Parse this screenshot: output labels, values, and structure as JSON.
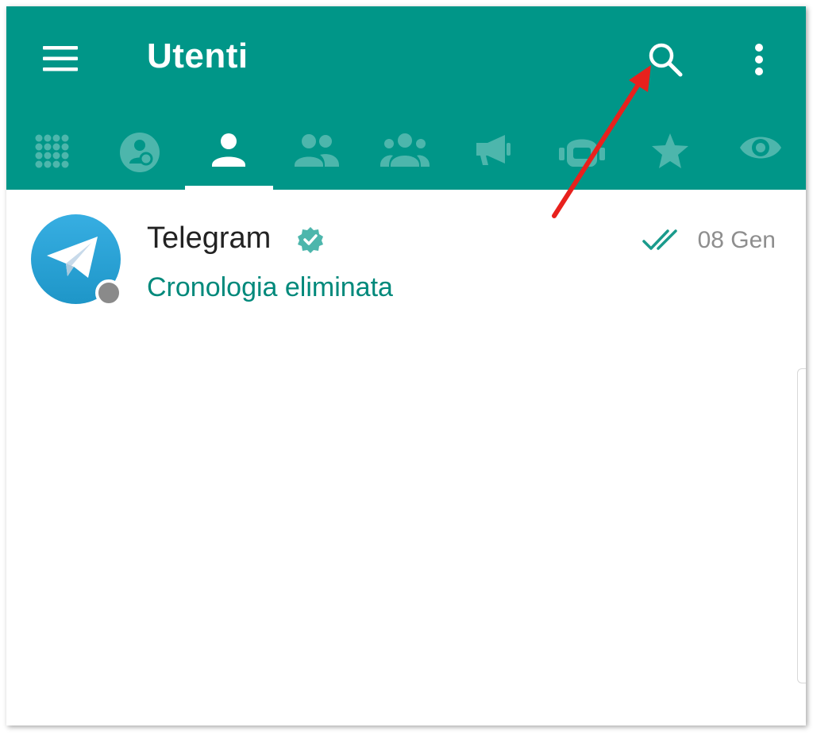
{
  "colors": {
    "appbar": "#009688",
    "tab_inactive": "#4db6ac",
    "tab_active": "#ffffff",
    "preview_text": "#00897b",
    "verified": "#4db6ac",
    "status_offline": "#8a8a8a",
    "annotation_arrow": "#e8211d"
  },
  "header": {
    "title": "Utenti",
    "menu_icon": "hamburger-menu-icon",
    "search_icon": "search-icon",
    "more_icon": "more-vertical-icon"
  },
  "tabs": [
    {
      "icon": "all-chats-grid-icon",
      "active": false
    },
    {
      "icon": "unread-contacts-icon",
      "active": false
    },
    {
      "icon": "user-icon",
      "active": true
    },
    {
      "icon": "group-icon",
      "active": false
    },
    {
      "icon": "supergroup-icon",
      "active": false
    },
    {
      "icon": "channel-megaphone-icon",
      "active": false
    },
    {
      "icon": "bot-icon",
      "active": false
    },
    {
      "icon": "favorites-star-icon",
      "active": false
    },
    {
      "icon": "unread-eye-icon",
      "active": false
    }
  ],
  "chats": [
    {
      "name": "Telegram",
      "verified": true,
      "preview": "Cronologia eliminata",
      "date": "08 Gen",
      "read_status": "double-check-icon",
      "online": false
    }
  ]
}
